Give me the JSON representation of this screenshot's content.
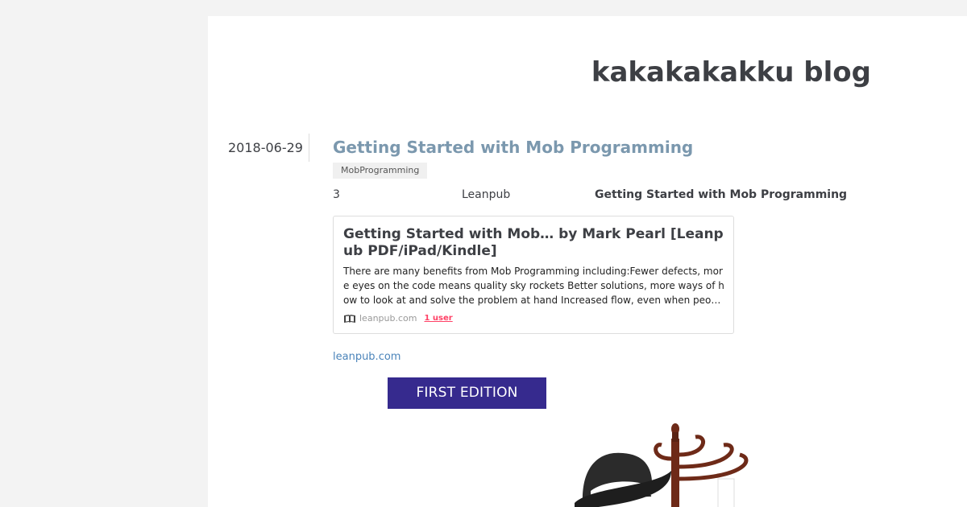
{
  "blog": {
    "title": "kakakakakku blog"
  },
  "entry": {
    "date": "2018-06-29",
    "title": "Getting Started with Mob Programming",
    "tag": "MobProgramming",
    "book_row": {
      "number": "3",
      "publisher": "Leanpub",
      "book_name": "Getting Started with Mob Programming"
    },
    "embed": {
      "title": "Getting Started with Mob… by Mark Pearl [Leanpub PDF/iPad/Kindle]",
      "description": "There are many benefits from Mob Programming including:Fewer defects, more eyes on the code means quality sky rockets Better solutions, more ways of how to look at and solve the problem at hand Increased flow, even when peo…",
      "domain": "leanpub.com",
      "users": "1 user",
      "icon": "book-favicon-icon"
    },
    "source_link": "leanpub.com",
    "cover": {
      "banner_text": "FIRST EDITION",
      "banner_color": "#362a8e"
    }
  },
  "colors": {
    "background": "#f3f3f3",
    "entry_title": "#7b98ae",
    "link": "#4b84ba",
    "users_badge": "#ff4166"
  }
}
